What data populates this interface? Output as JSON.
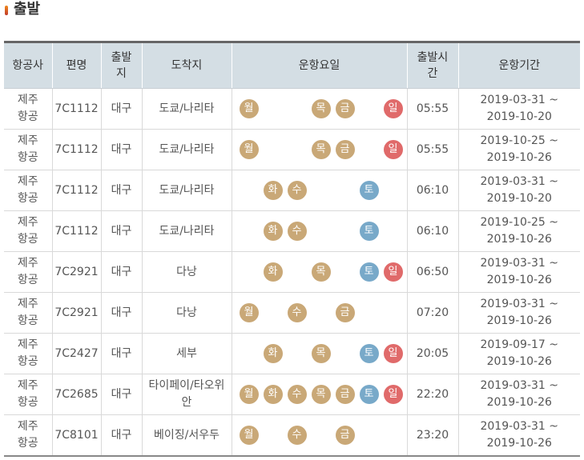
{
  "page": {
    "title": "출발"
  },
  "colors": {
    "weekday": "#c9a877",
    "saturday": "#78a9c9",
    "sunday": "#e06a6a",
    "header_bg": "#d4dee4"
  },
  "table": {
    "headers": [
      "항공사",
      "편명",
      "출발지",
      "도착지",
      "운항요일",
      "출발시간",
      "운항기간"
    ],
    "rows": [
      {
        "airline": "제주항공",
        "flight": "7C1112",
        "departure": "대구",
        "arrival": "도쿄/나리타",
        "days": [
          "월",
          "",
          "",
          "목",
          "금",
          "",
          "일"
        ],
        "time": "05:55",
        "period": "2019-03-31 ~ 2019-10-20"
      },
      {
        "airline": "제주항공",
        "flight": "7C1112",
        "departure": "대구",
        "arrival": "도쿄/나리타",
        "days": [
          "월",
          "",
          "",
          "목",
          "금",
          "",
          "일"
        ],
        "time": "05:55",
        "period": "2019-10-25 ~ 2019-10-26"
      },
      {
        "airline": "제주항공",
        "flight": "7C1112",
        "departure": "대구",
        "arrival": "도쿄/나리타",
        "days": [
          "",
          "화",
          "수",
          "",
          "",
          "토",
          ""
        ],
        "time": "06:10",
        "period": "2019-03-31 ~ 2019-10-20"
      },
      {
        "airline": "제주항공",
        "flight": "7C1112",
        "departure": "대구",
        "arrival": "도쿄/나리타",
        "days": [
          "",
          "화",
          "수",
          "",
          "",
          "토",
          ""
        ],
        "time": "06:10",
        "period": "2019-10-25 ~ 2019-10-26"
      },
      {
        "airline": "제주항공",
        "flight": "7C2921",
        "departure": "대구",
        "arrival": "다낭",
        "days": [
          "",
          "화",
          "",
          "목",
          "",
          "토",
          "일"
        ],
        "time": "06:50",
        "period": "2019-03-31 ~ 2019-10-26"
      },
      {
        "airline": "제주항공",
        "flight": "7C2921",
        "departure": "대구",
        "arrival": "다낭",
        "days": [
          "월",
          "",
          "수",
          "",
          "금",
          "",
          ""
        ],
        "time": "07:20",
        "period": "2019-03-31 ~ 2019-10-26"
      },
      {
        "airline": "제주항공",
        "flight": "7C2427",
        "departure": "대구",
        "arrival": "세부",
        "days": [
          "",
          "화",
          "",
          "목",
          "",
          "토",
          "일"
        ],
        "time": "20:05",
        "period": "2019-09-17 ~ 2019-10-26"
      },
      {
        "airline": "제주항공",
        "flight": "7C2685",
        "departure": "대구",
        "arrival": "타이페이/타오위안",
        "days": [
          "월",
          "화",
          "수",
          "목",
          "금",
          "토",
          "일"
        ],
        "time": "22:20",
        "period": "2019-03-31 ~ 2019-10-26"
      },
      {
        "airline": "제주항공",
        "flight": "7C8101",
        "departure": "대구",
        "arrival": "베이징/서우두",
        "days": [
          "월",
          "",
          "수",
          "",
          "금",
          "",
          ""
        ],
        "time": "23:20",
        "period": "2019-03-31 ~ 2019-10-26"
      }
    ]
  }
}
